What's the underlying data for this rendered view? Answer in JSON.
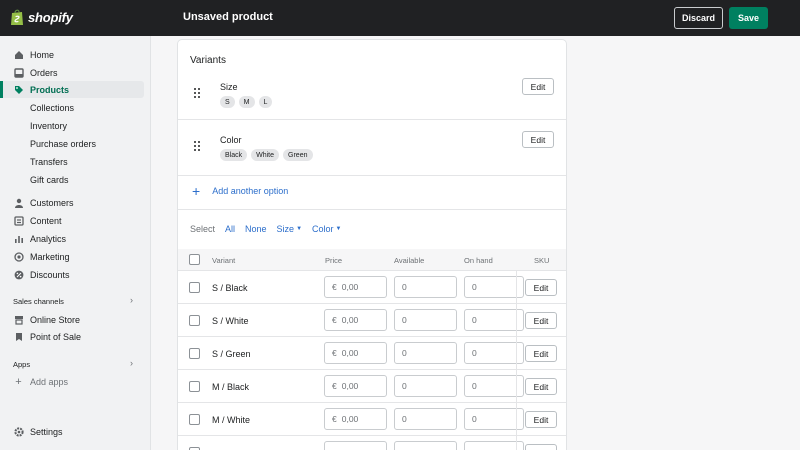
{
  "app": {
    "logo_text": "shopify",
    "page_title": "Unsaved product"
  },
  "actions": {
    "discard": "Discard",
    "save": "Save"
  },
  "sidebar": {
    "items": [
      {
        "label": "Home",
        "icon": "home-icon"
      },
      {
        "label": "Orders",
        "icon": "orders-icon"
      },
      {
        "label": "Products",
        "icon": "tag-icon",
        "active": true
      }
    ],
    "product_sub": [
      "Collections",
      "Inventory",
      "Purchase orders",
      "Transfers",
      "Gift cards"
    ],
    "items2": [
      {
        "label": "Customers",
        "icon": "person-icon"
      },
      {
        "label": "Content",
        "icon": "content-icon"
      },
      {
        "label": "Analytics",
        "icon": "chart-icon"
      },
      {
        "label": "Marketing",
        "icon": "target-icon"
      },
      {
        "label": "Discounts",
        "icon": "discount-icon"
      }
    ],
    "sales_channels_label": "Sales channels",
    "channels": [
      {
        "label": "Online Store",
        "icon": "store-icon"
      },
      {
        "label": "Point of Sale",
        "icon": "pos-icon"
      }
    ],
    "apps_label": "Apps",
    "add_apps": "Add apps",
    "settings": "Settings"
  },
  "variants_card": {
    "title": "Variants",
    "options": [
      {
        "name": "Size",
        "values": [
          "S",
          "M",
          "L"
        ],
        "edit": "Edit"
      },
      {
        "name": "Color",
        "values": [
          "Black",
          "White",
          "Green"
        ],
        "edit": "Edit"
      }
    ],
    "add_option": "Add another option",
    "select": {
      "label": "Select",
      "all": "All",
      "none": "None",
      "size": "Size",
      "color": "Color"
    },
    "columns": {
      "variant": "Variant",
      "price": "Price",
      "available": "Available",
      "on_hand": "On hand",
      "sku": "SKU"
    },
    "currency": "€",
    "price_placeholder": "0,00",
    "rows": [
      {
        "variant": "S / Black",
        "available": "0",
        "on_hand": "0",
        "edit": "Edit"
      },
      {
        "variant": "S / White",
        "available": "0",
        "on_hand": "0",
        "edit": "Edit"
      },
      {
        "variant": "S / Green",
        "available": "0",
        "on_hand": "0",
        "edit": "Edit"
      },
      {
        "variant": "M / Black",
        "available": "0",
        "on_hand": "0",
        "edit": "Edit"
      },
      {
        "variant": "M / White",
        "available": "0",
        "on_hand": "0",
        "edit": "Edit"
      }
    ]
  },
  "colors": {
    "save_green": "#008060",
    "topbar": "#202123",
    "link_blue": "#2c6ecb"
  }
}
